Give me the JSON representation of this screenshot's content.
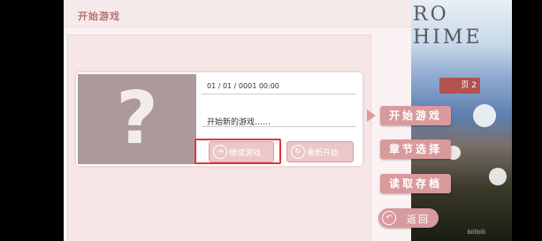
{
  "panel": {
    "title": "开始游戏"
  },
  "save_slot": {
    "thumbnail_placeholder": "?",
    "date": "01 / 01 / 0001 00:00",
    "description": "开始新的游戏……",
    "continue_label": "继续游戏",
    "restart_label": "重新开始"
  },
  "menu": {
    "start_game": "开始游戏",
    "chapter_select": "章节选择",
    "load_save": "读取存档",
    "back": "返回"
  },
  "background": {
    "logo_line1": "RO",
    "logo_line2": "HIME",
    "tag_text": "页 2",
    "watermark": "bilibili"
  },
  "colors": {
    "accent": "#d99a9e",
    "highlight": "#e53535",
    "panel_bg": "#fbf3f3"
  }
}
